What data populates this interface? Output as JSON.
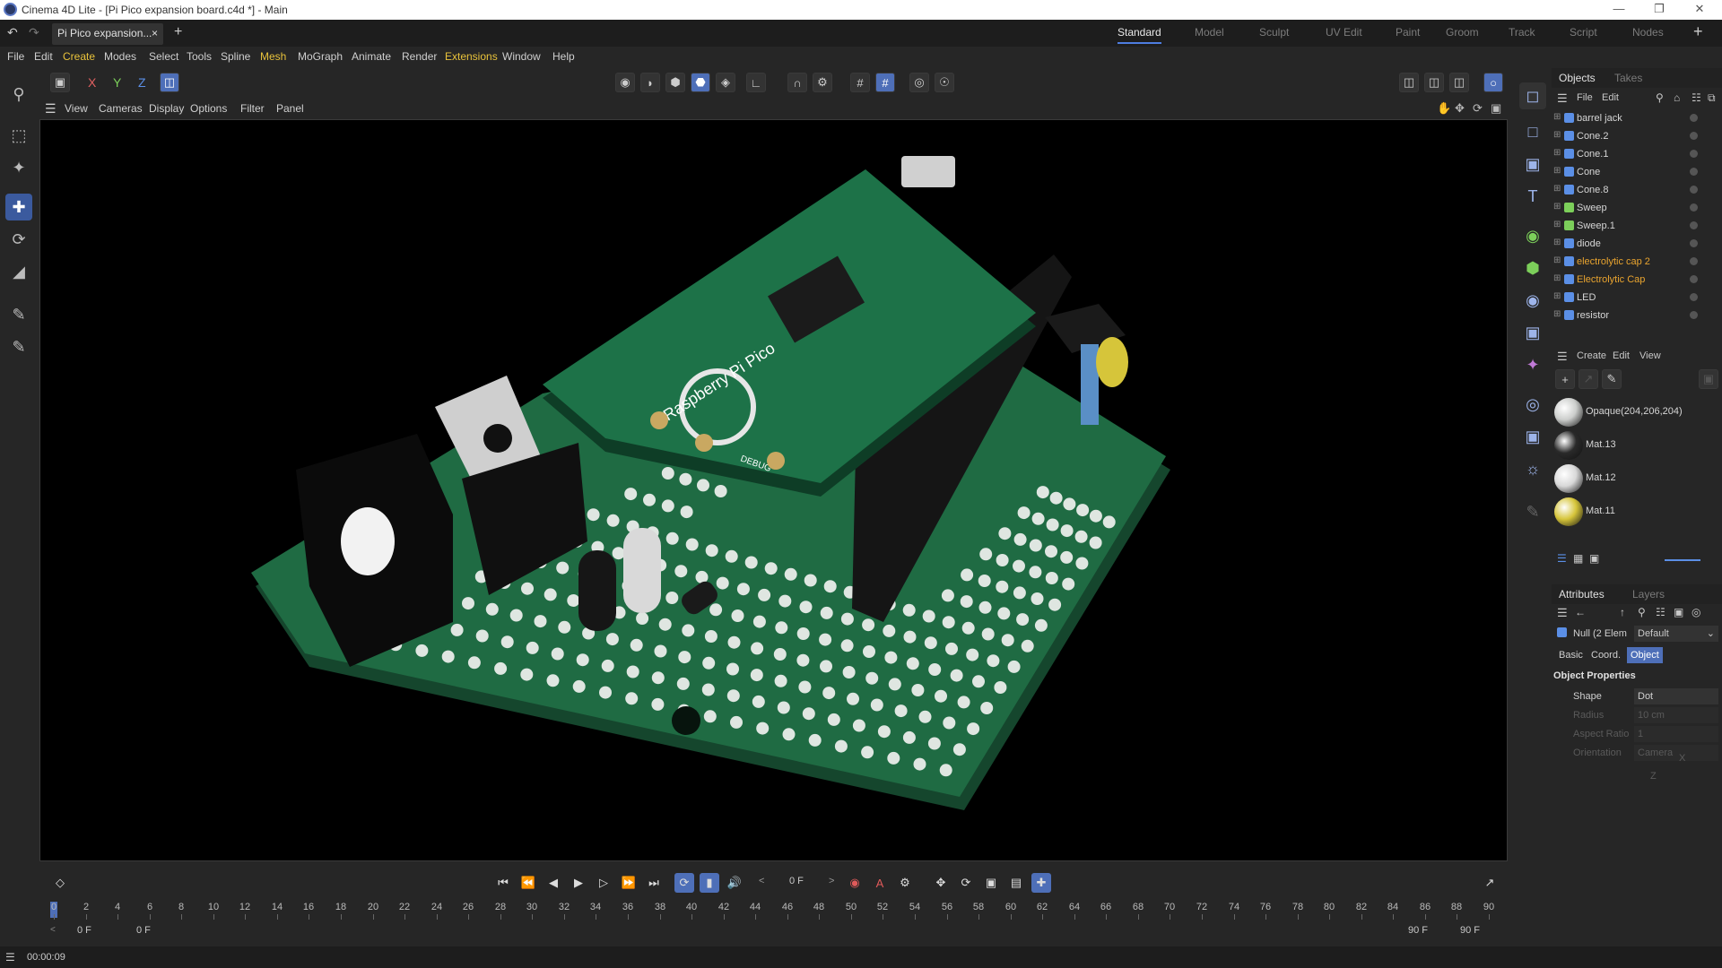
{
  "window": {
    "title": "Cinema 4D Lite - [Pi Pico expansion board.c4d *] - Main"
  },
  "tabs": {
    "document": "Pi Pico expansion...",
    "close": "×",
    "add": "+"
  },
  "layouts": [
    "Standard",
    "Model",
    "Sculpt",
    "UV Edit",
    "Paint",
    "Groom",
    "Track",
    "Script",
    "Nodes"
  ],
  "menu": [
    "File",
    "Edit",
    "Create",
    "Modes",
    "Select",
    "Tools",
    "Spline",
    "Mesh",
    "MoGraph",
    "Animate",
    "Render",
    "Extensions",
    "Window",
    "Help"
  ],
  "axis": {
    "x": "X",
    "y": "Y",
    "z": "Z"
  },
  "viewport_menu": [
    "View",
    "Cameras",
    "Display",
    "Options",
    "Filter",
    "Panel"
  ],
  "board": {
    "label": "Raspberry Pi Pico",
    "debug": "DEBUG"
  },
  "objects_panel": {
    "tabs": [
      "Objects",
      "Takes"
    ],
    "menu": [
      "File",
      "Edit"
    ],
    "items": [
      {
        "name": "barrel jack",
        "icon": "null-icon",
        "warn": false
      },
      {
        "name": "Cone.2",
        "icon": "cone-icon",
        "warn": false
      },
      {
        "name": "Cone.1",
        "icon": "cone-icon",
        "warn": false
      },
      {
        "name": "Cone",
        "icon": "cone-icon",
        "warn": false
      },
      {
        "name": "Cone.8",
        "icon": "cone-icon",
        "warn": false
      },
      {
        "name": "Sweep",
        "icon": "sweep-icon",
        "warn": false
      },
      {
        "name": "Sweep.1",
        "icon": "sweep-icon",
        "warn": false
      },
      {
        "name": "diode",
        "icon": "cone-icon",
        "warn": false
      },
      {
        "name": "electrolytic cap 2",
        "icon": "null-icon",
        "warn": true
      },
      {
        "name": "Electrolytic Cap",
        "icon": "null-icon",
        "warn": true
      },
      {
        "name": "LED",
        "icon": "null-icon",
        "warn": false
      },
      {
        "name": "resistor",
        "icon": "null-icon",
        "warn": false
      }
    ]
  },
  "materials_panel": {
    "menu": [
      "Create",
      "Edit",
      "View"
    ],
    "items": [
      {
        "name": "Opaque(204,206,204)",
        "color": "#cccecc"
      },
      {
        "name": "Mat.13",
        "color": "#2a2a2a"
      },
      {
        "name": "Mat.12",
        "color": "#d8d8d8"
      },
      {
        "name": "Mat.11",
        "color": "#d6c53a"
      }
    ]
  },
  "attributes_panel": {
    "tabs": [
      "Attributes",
      "Layers"
    ],
    "object": "Null (2 Elem",
    "preset": "Default",
    "subtabs": [
      "Basic",
      "Coord.",
      "Object"
    ],
    "section": "Object Properties",
    "fields": [
      {
        "label": "Shape",
        "value": "Dot",
        "dim": false
      },
      {
        "label": "Radius",
        "value": "10 cm",
        "dim": true
      },
      {
        "label": "Aspect Ratio",
        "value": "1",
        "dim": true
      },
      {
        "label": "Orientation",
        "value": "Camera",
        "dim": true
      }
    ],
    "orientation_axes": [
      "X",
      "Z"
    ]
  },
  "timeline": {
    "current_frame": "0 F",
    "start_frame": "0 F",
    "preview_start": "0 F",
    "preview_end": "90 F",
    "end_frame": "90 F",
    "ticks": [
      "0",
      "2",
      "4",
      "6",
      "8",
      "10",
      "12",
      "14",
      "16",
      "18",
      "20",
      "22",
      "24",
      "26",
      "28",
      "30",
      "32",
      "34",
      "36",
      "38",
      "40",
      "42",
      "44",
      "46",
      "48",
      "50",
      "52",
      "54",
      "56",
      "58",
      "60",
      "62",
      "64",
      "66",
      "68",
      "70",
      "72",
      "74",
      "76",
      "78",
      "80",
      "82",
      "84",
      "86",
      "88",
      "90"
    ]
  },
  "status": {
    "time": "00:00:09"
  },
  "colors": {
    "accent": "#4e7de0",
    "board": "#1f6b43",
    "warn": "#e9a42f",
    "highlight_menu": "#e8c23b"
  }
}
